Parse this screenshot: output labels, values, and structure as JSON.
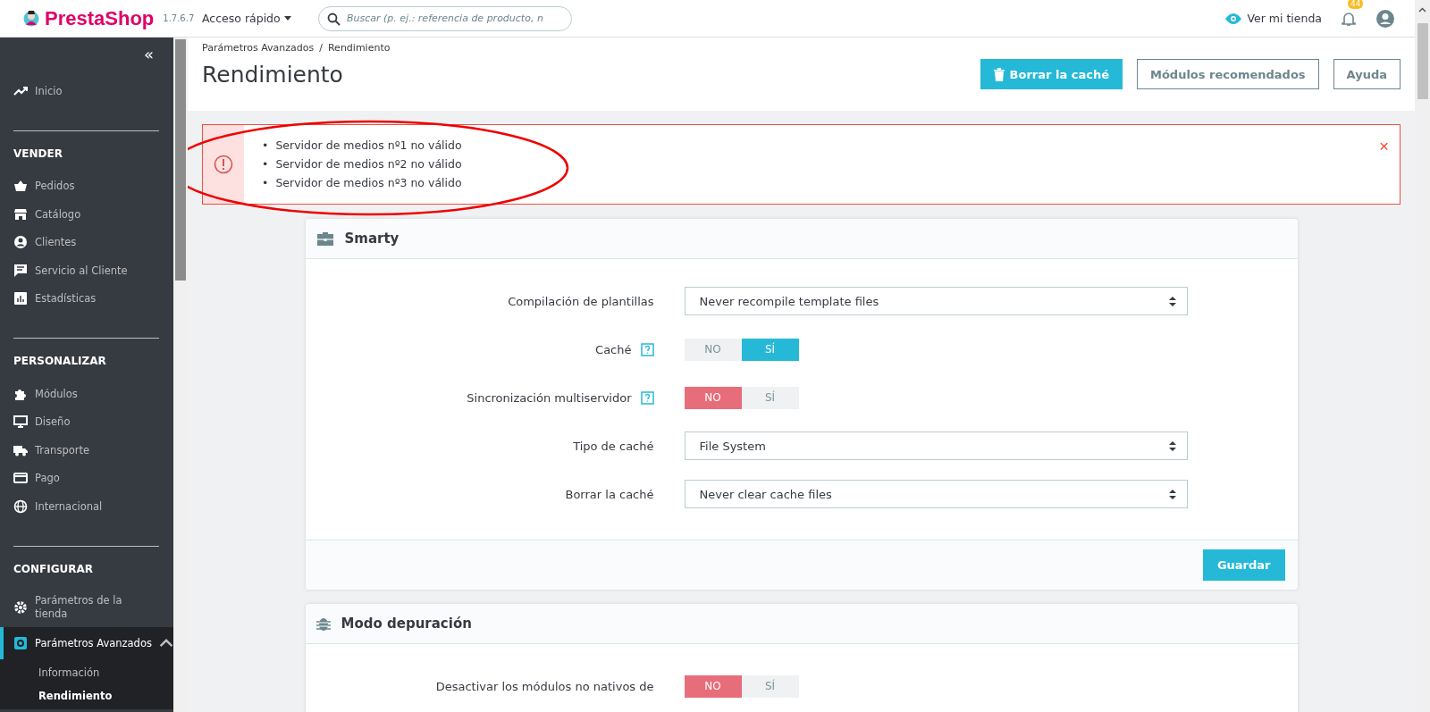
{
  "header": {
    "logo": "PrestaShop",
    "version": "1.7.6.7",
    "quick_access": "Acceso rápido",
    "search": {
      "placeholder": "Buscar (p. ej.: referencia de producto, n"
    },
    "view_shop": "Ver mi tienda",
    "notifications": "44"
  },
  "sidebar": {
    "collapse": "«",
    "top": [
      {
        "label": "Inicio",
        "selected": false
      }
    ],
    "sections": [
      {
        "title": "VENDER",
        "items": [
          {
            "label": "Pedidos",
            "selected": false
          },
          {
            "label": "Catálogo",
            "selected": false
          },
          {
            "label": "Clientes",
            "selected": false
          },
          {
            "label": "Servicio al Cliente",
            "selected": false
          },
          {
            "label": "Estadísticas",
            "selected": false
          }
        ]
      },
      {
        "title": "PERSONALIZAR",
        "items": [
          {
            "label": "Módulos",
            "selected": false
          },
          {
            "label": "Diseño",
            "selected": false
          },
          {
            "label": "Transporte",
            "selected": false
          },
          {
            "label": "Pago",
            "selected": false
          },
          {
            "label": "Internacional",
            "selected": false
          }
        ]
      },
      {
        "title": "CONFIGURAR",
        "items": [
          {
            "label": "Parámetros de la tienda",
            "selected": false
          },
          {
            "label": "Parámetros Avanzados",
            "selected": true,
            "expanded": true,
            "children": [
              {
                "label": "Información",
                "selected": false
              },
              {
                "label": "Rendimiento",
                "selected": true
              }
            ]
          }
        ]
      }
    ]
  },
  "breadcrumb": [
    "Parámetros Avanzados",
    "Rendimiento"
  ],
  "breadcrumb_separator": "/",
  "title": "Rendimiento",
  "toolbar": [
    {
      "label": "Borrar la caché",
      "kind": "primary"
    },
    {
      "label": "Módulos recomendados",
      "kind": "outline"
    },
    {
      "label": "Ayuda",
      "kind": "outline"
    }
  ],
  "alert": {
    "bullet": "•",
    "messages": [
      "Servidor de medios nº1 no válido",
      "Servidor de medios nº2 no válido",
      "Servidor de medios nº3 no válido"
    ],
    "close": "×"
  },
  "cards": [
    {
      "title": "Smarty",
      "rows": [
        {
          "label": "Compilación de plantillas",
          "kind": "select",
          "value": "Never recompile template files"
        },
        {
          "label": "Caché",
          "kind": "switch",
          "off": "NO",
          "on_label": "SÍ",
          "on": true,
          "help": true
        },
        {
          "label": "Sincronización multiservidor",
          "kind": "switch",
          "off": "NO",
          "on_label": "SÍ",
          "on": false,
          "help": true
        },
        {
          "label": "Tipo de caché",
          "kind": "select",
          "value": "File System"
        },
        {
          "label": "Borrar la caché",
          "kind": "select",
          "value": "Never clear cache files"
        }
      ],
      "save": "Guardar"
    },
    {
      "title": "Modo depuración",
      "rows": [
        {
          "label": "Desactivar los módulos no nativos de",
          "kind": "switch",
          "off": "NO",
          "on_label": "SÍ",
          "on": false
        }
      ]
    }
  ]
}
